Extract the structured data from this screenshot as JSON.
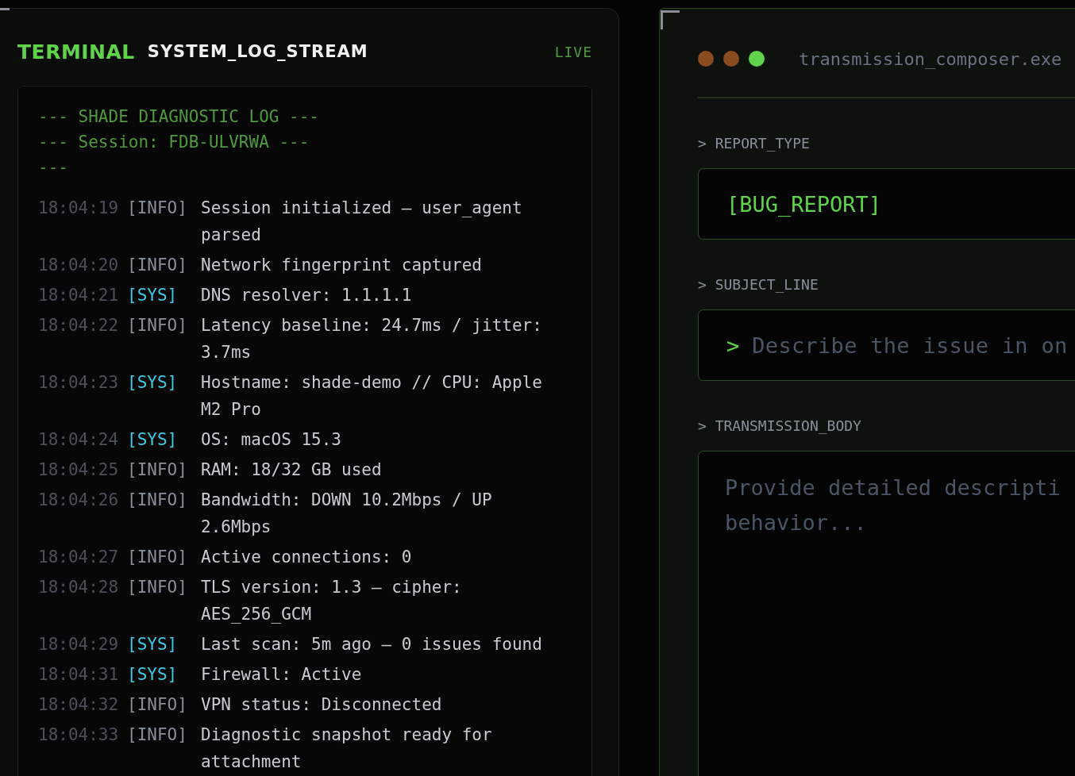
{
  "terminal": {
    "title": "TERMINAL",
    "subtitle": "SYSTEM_LOG_STREAM",
    "status": "LIVE",
    "banner": [
      "--- SHADE DIAGNOSTIC LOG ---",
      "--- Session: FDB-ULVRWA ---",
      "---"
    ],
    "entries": [
      {
        "time": "18:04:19",
        "tag": "[INFO]",
        "kind": "info",
        "message": "Session initialized — user_agent parsed"
      },
      {
        "time": "18:04:20",
        "tag": "[INFO]",
        "kind": "info",
        "message": "Network fingerprint captured"
      },
      {
        "time": "18:04:21",
        "tag": "[SYS]",
        "kind": "sys",
        "message": "DNS resolver: 1.1.1.1"
      },
      {
        "time": "18:04:22",
        "tag": "[INFO]",
        "kind": "info",
        "message": "Latency baseline: 24.7ms / jitter: 3.7ms"
      },
      {
        "time": "18:04:23",
        "tag": "[SYS]",
        "kind": "sys",
        "message": "Hostname: shade-demo // CPU: Apple M2 Pro"
      },
      {
        "time": "18:04:24",
        "tag": "[SYS]",
        "kind": "sys",
        "message": "OS: macOS 15.3"
      },
      {
        "time": "18:04:25",
        "tag": "[INFO]",
        "kind": "info",
        "message": "RAM: 18/32 GB used"
      },
      {
        "time": "18:04:26",
        "tag": "[INFO]",
        "kind": "info",
        "message": "Bandwidth: DOWN 10.2Mbps / UP 2.6Mbps"
      },
      {
        "time": "18:04:27",
        "tag": "[INFO]",
        "kind": "info",
        "message": "Active connections: 0"
      },
      {
        "time": "18:04:28",
        "tag": "[INFO]",
        "kind": "info",
        "message": "TLS version: 1.3 — cipher: AES_256_GCM"
      },
      {
        "time": "18:04:29",
        "tag": "[SYS]",
        "kind": "sys",
        "message": "Last scan: 5m ago — 0 issues found"
      },
      {
        "time": "18:04:31",
        "tag": "[SYS]",
        "kind": "sys",
        "message": "Firewall: Active"
      },
      {
        "time": "18:04:32",
        "tag": "[INFO]",
        "kind": "info",
        "message": "VPN status: Disconnected"
      },
      {
        "time": "18:04:33",
        "tag": "[INFO]",
        "kind": "info",
        "message": "Diagnostic snapshot ready for attachment"
      }
    ]
  },
  "composer": {
    "title": "transmission_composer.exe",
    "dots": [
      {
        "color": "#8a4b1f"
      },
      {
        "color": "#8a4b1f"
      },
      {
        "color": "#5fd44b"
      }
    ],
    "fields": [
      {
        "kind": "select",
        "label": "> REPORT_TYPE",
        "value": "[BUG_REPORT]"
      },
      {
        "kind": "input",
        "label": "> SUBJECT_LINE",
        "prompt": ">",
        "placeholder": "Describe the issue in on"
      },
      {
        "kind": "textarea",
        "label": "> TRANSMISSION_BODY",
        "placeholder": "Provide detailed descripti behavior..."
      }
    ]
  }
}
